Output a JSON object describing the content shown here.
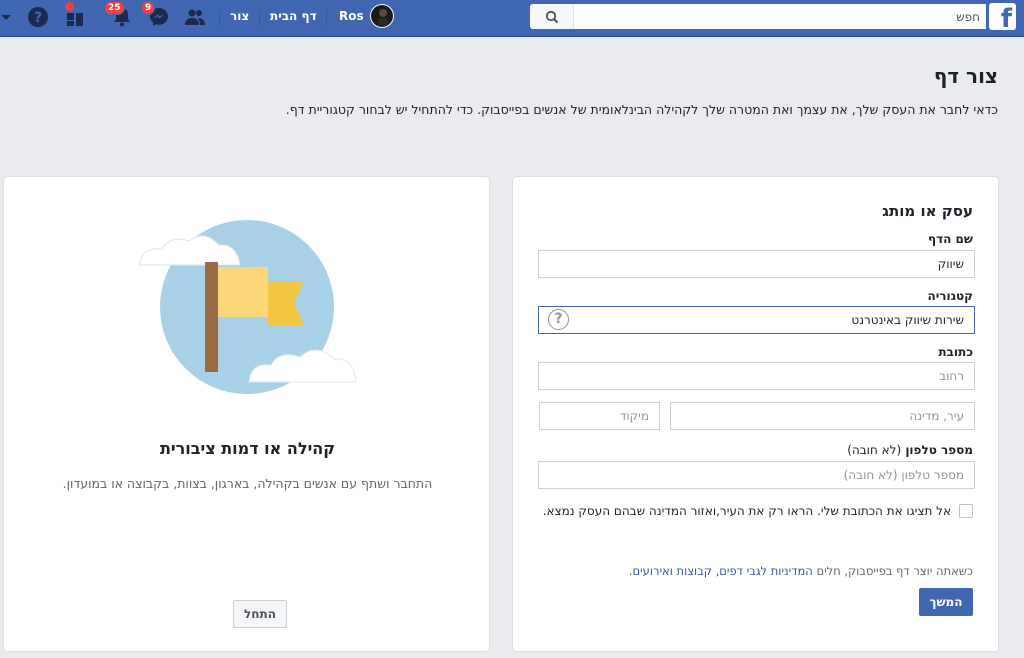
{
  "topbar": {
    "logo": "f",
    "search_placeholder": "חפש",
    "user_name": "Ros",
    "home_label": "דף הבית",
    "create_label": "צור",
    "notifications_count": "25",
    "messages_count": "9",
    "icons": [
      "facebook-logo-icon",
      "search-icon",
      "avatar",
      "friends-icon",
      "messenger-icon",
      "notifications-icon",
      "quick-help-icon",
      "help-icon",
      "dropdown-icon"
    ],
    "colors": {
      "bar": "#4267b2",
      "badge": "#fa3e3e"
    }
  },
  "page": {
    "title": "צור דף",
    "description": "כדאי לחבר את העסק שלך, את עצמך ואת המטרה שלך לקהילה הבינלאומית של אנשים בפייסבוק. כדי להתחיל יש לבחור קטגוריית דף."
  },
  "business_card": {
    "title": "עסק או מותג",
    "page_name_label": "שם הדף",
    "page_name_value": "שיווק",
    "category_label": "קטגוריה",
    "category_value": "שירות שיווק באינטרנט",
    "address_label": "כתובת",
    "street_placeholder": "רחוב",
    "city_placeholder": "עיר, מדינה",
    "zip_placeholder": "מיקוד",
    "phone_label": "מספר טלפון",
    "phone_optional": "(לא חובה)",
    "phone_placeholder": "מספר טלפון (לא חובה)",
    "hide_address_label": "אל תציגו את הכתובת שלי. הראו רק את העיר,ואזור המדינה שבהם העסק נמצא.",
    "hide_address_checked": false,
    "policy_prefix": "כשאתה יוצר דף בפייסבוק, חלים ",
    "policy_link": "המדיניות לגבי דפים, קבוצות ואירועים",
    "policy_suffix": ".",
    "continue_label": "המשך"
  },
  "community_card": {
    "title": "קהילה או דמות ציבורית",
    "description": "התחבר ושתף עם אנשים בקהילה, בארגון, בצוות, בקבוצה או במועדון.",
    "start_label": "התחל",
    "illustration": "flag-illustration"
  }
}
